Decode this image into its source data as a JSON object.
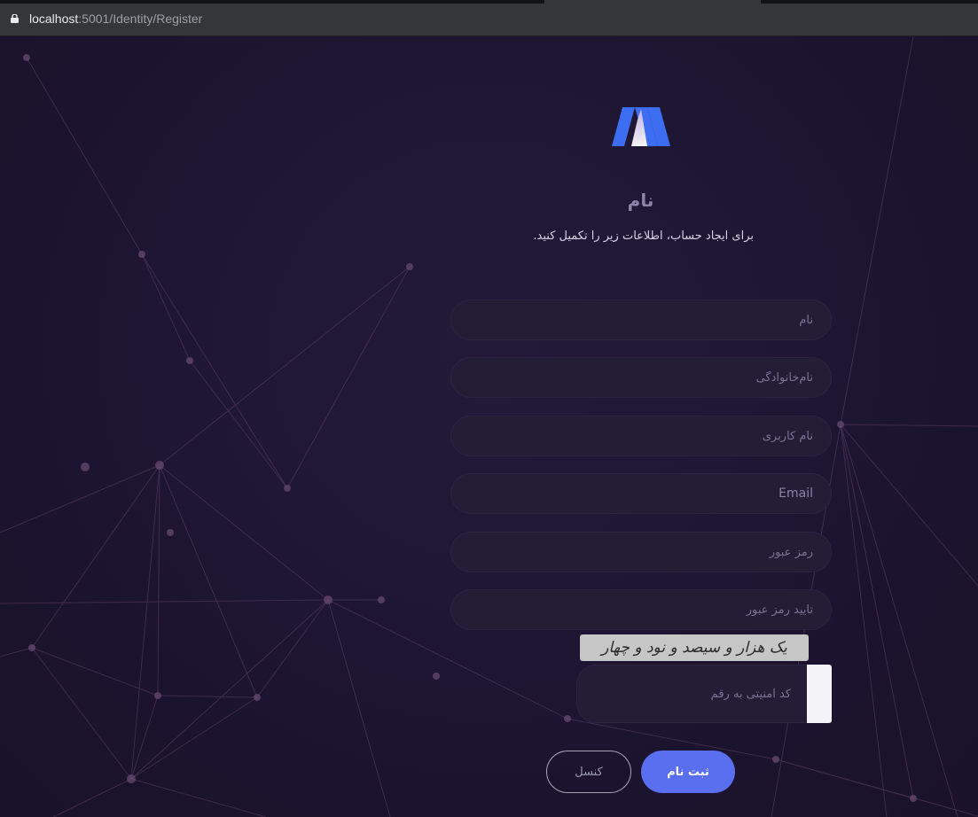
{
  "browser": {
    "url_host": "localhost",
    "url_rest": ":5001/Identity/Register"
  },
  "icons": {
    "lock": "lock-icon",
    "logo": "brand-logo"
  },
  "colors": {
    "accent": "#5a6ff0",
    "background": "#1e1630",
    "field": "#241d36",
    "logo_blue": "#3d6ef2"
  },
  "form": {
    "title": "نام",
    "subtitle": "برای ایجاد حساب، اطلاعات زیر را تکمیل کنید.",
    "first_name": {
      "placeholder": "نام",
      "value": ""
    },
    "last_name": {
      "placeholder": "نام‌خانوادگی",
      "value": ""
    },
    "username": {
      "placeholder": "نام کاربری",
      "value": ""
    },
    "email": {
      "placeholder": "Email",
      "value": ""
    },
    "password": {
      "placeholder": "رمز عبور",
      "value": ""
    },
    "confirm_password": {
      "placeholder": "تایید رمز عبور",
      "value": ""
    },
    "captcha_text": "یک هزار و سیصد و نود و چهار",
    "captcha_input": {
      "placeholder": "کد امنیتی به رقم",
      "value": ""
    },
    "submit_label": "ثبت نام",
    "cancel_label": "کنسل"
  }
}
